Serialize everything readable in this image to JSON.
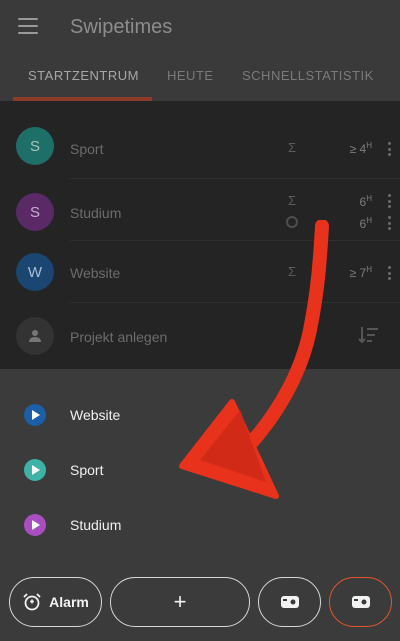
{
  "app": {
    "title": "Swipetimes"
  },
  "tabs": [
    {
      "label": "STARTZENTRUM"
    },
    {
      "label": "HEUTE"
    },
    {
      "label": "SCHNELLSTATISTIK"
    }
  ],
  "projects": [
    {
      "initial": "S",
      "name": "Sport",
      "color": "#1f6f69",
      "value1": "≥ 4",
      "unit": "H"
    },
    {
      "initial": "S",
      "name": "Studium",
      "color": "#5a2a66",
      "value1": "6",
      "value2": "6",
      "unit": "H"
    },
    {
      "initial": "W",
      "name": "Website",
      "color": "#1a4671",
      "value1": "≥ 7",
      "unit": "H"
    }
  ],
  "create_project": {
    "label": "Projekt anlegen"
  },
  "sheet": {
    "items": [
      {
        "label": "Website",
        "color": "#1a5fa8",
        "icon": "play-icon"
      },
      {
        "label": "Sport",
        "color": "#3fb2a6",
        "icon": "play-icon"
      },
      {
        "label": "Studium",
        "color": "#a94ec1",
        "icon": "play-icon"
      }
    ]
  },
  "buttons": {
    "alarm_label": "Alarm",
    "add_label": "+",
    "accent": "#e2552f"
  },
  "annotation": {
    "color": "#e8321c"
  }
}
